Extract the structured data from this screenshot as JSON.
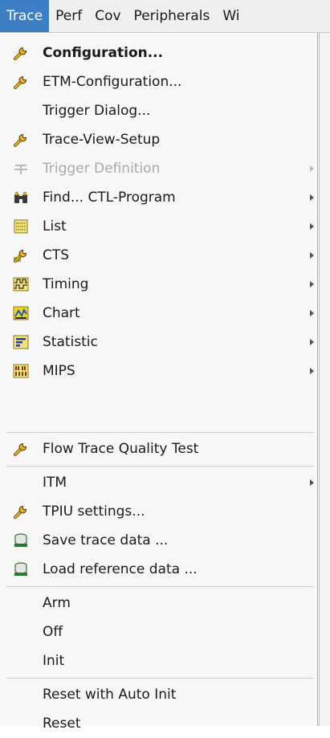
{
  "menubar": {
    "items": [
      "Trace",
      "Perf",
      "Cov",
      "Peripherals",
      "Wi"
    ],
    "active": "Trace"
  },
  "menu": {
    "items": [
      {
        "label": "Configuration...",
        "icon": "wrench-icon",
        "submenu": false,
        "bold": true
      },
      {
        "label": "ETM-Configuration...",
        "icon": "wrench-icon",
        "submenu": false
      },
      {
        "label": "Trigger Dialog...",
        "icon": "",
        "submenu": false
      },
      {
        "label": "Trace-View-Setup",
        "icon": "wrench-icon",
        "submenu": false
      },
      {
        "label": "Trigger Definition",
        "icon": "trigger-icon",
        "submenu": true,
        "disabled": true
      },
      {
        "label": "Find... CTL-Program",
        "icon": "binoculars-icon",
        "submenu": true
      },
      {
        "label": "List",
        "icon": "list-icon",
        "submenu": true
      },
      {
        "label": "CTS",
        "icon": "cts-wrench-icon",
        "submenu": true
      },
      {
        "label": "Timing",
        "icon": "timing-icon",
        "submenu": true
      },
      {
        "label": "Chart",
        "icon": "chart-icon",
        "submenu": true
      },
      {
        "label": "Statistic",
        "icon": "statistic-icon",
        "submenu": true
      },
      {
        "label": "MIPS",
        "icon": "mips-icon",
        "submenu": true
      },
      {
        "label": "Flow Trace Quality Test",
        "icon": "wrench-icon",
        "submenu": false
      },
      {
        "label": "ITM",
        "icon": "",
        "submenu": true
      },
      {
        "label": "TPIU settings...",
        "icon": "wrench-icon",
        "submenu": false
      },
      {
        "label": "Save trace data ...",
        "icon": "save-data-icon",
        "submenu": false
      },
      {
        "label": "Load reference data ...",
        "icon": "load-data-icon",
        "submenu": false
      },
      {
        "label": "Arm",
        "icon": "",
        "submenu": false
      },
      {
        "label": "Off",
        "icon": "",
        "submenu": false
      },
      {
        "label": "Init",
        "icon": "",
        "submenu": false
      },
      {
        "label": "Reset with Auto Init",
        "icon": "",
        "submenu": false
      },
      {
        "label": "Reset",
        "icon": "",
        "submenu": false
      }
    ]
  },
  "colors": {
    "menubar_highlight": "#3d7fc4",
    "menu_background": "#f7f7f7",
    "disabled_text": "#a9a9a9"
  }
}
